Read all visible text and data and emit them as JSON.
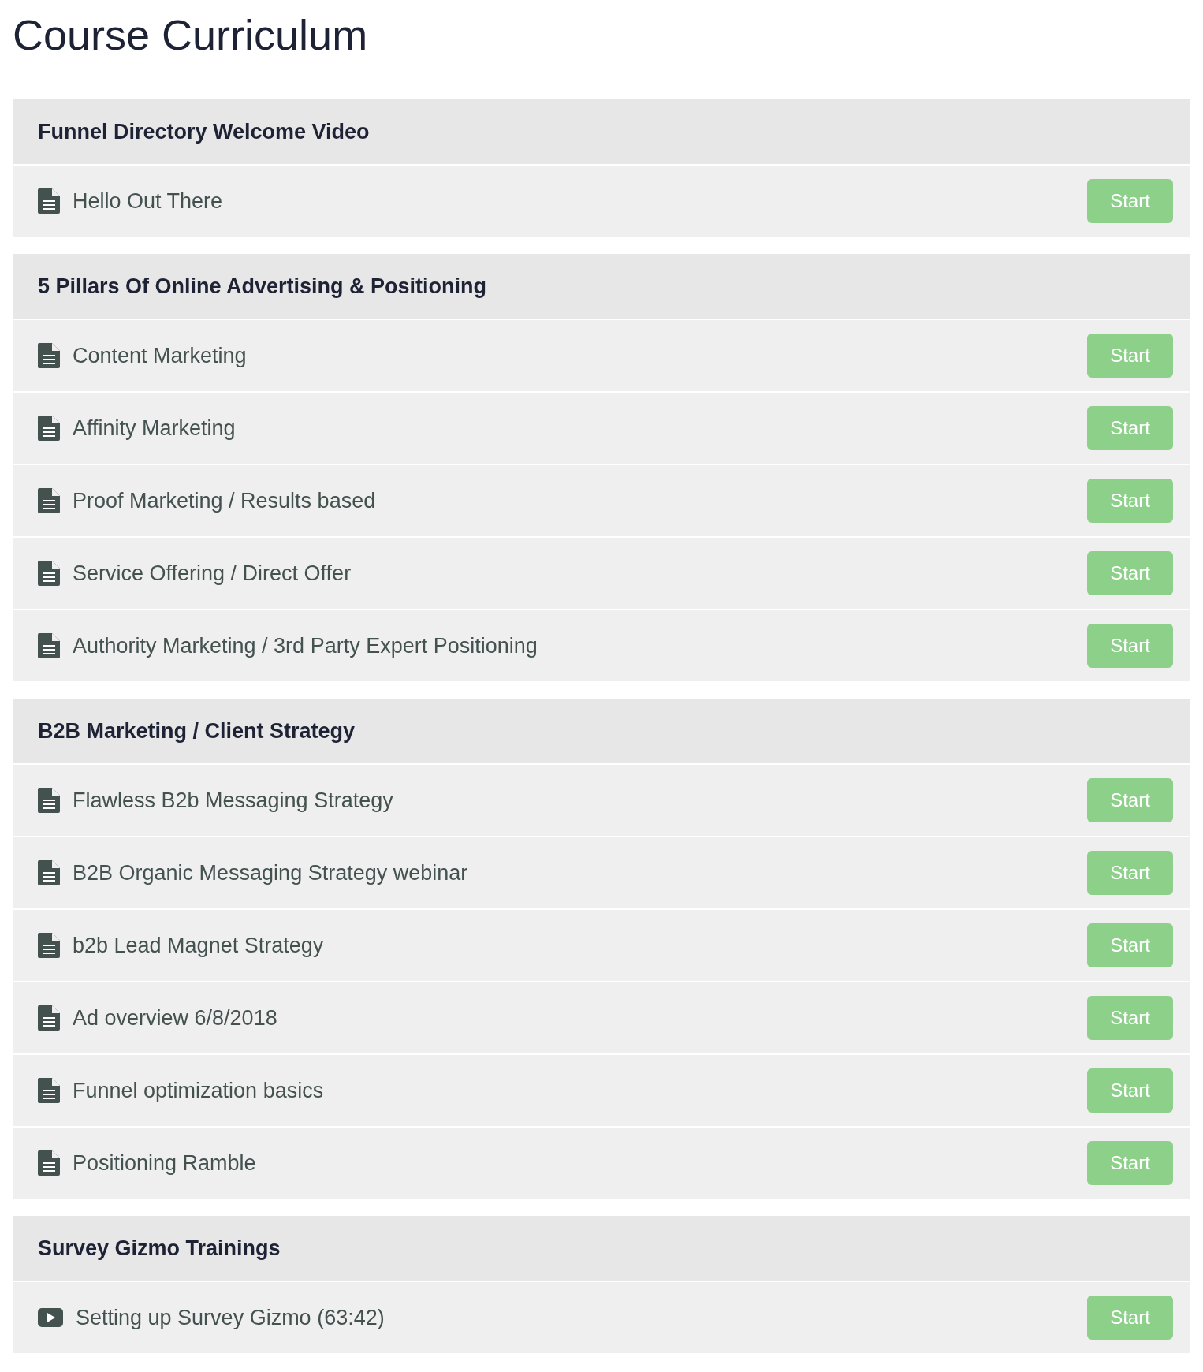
{
  "title": "Course Curriculum",
  "sections": [
    {
      "title": "Funnel Directory Welcome Video",
      "lessons": [
        {
          "kind": "document",
          "title": "Hello Out There",
          "button": "Start"
        }
      ]
    },
    {
      "title": "5 Pillars Of Online Advertising & Positioning",
      "lessons": [
        {
          "kind": "document",
          "title": "Content Marketing",
          "button": "Start"
        },
        {
          "kind": "document",
          "title": "Affinity Marketing",
          "button": "Start"
        },
        {
          "kind": "document",
          "title": "Proof Marketing / Results based",
          "button": "Start"
        },
        {
          "kind": "document",
          "title": "Service Offering / Direct Offer",
          "button": "Start"
        },
        {
          "kind": "document",
          "title": "Authority Marketing / 3rd Party Expert Positioning",
          "button": "Start"
        }
      ]
    },
    {
      "title": "B2B Marketing / Client Strategy",
      "lessons": [
        {
          "kind": "document",
          "title": "Flawless B2b Messaging Strategy",
          "button": "Start"
        },
        {
          "kind": "document",
          "title": "B2B Organic Messaging Strategy webinar",
          "button": "Start"
        },
        {
          "kind": "document",
          "title": "b2b Lead Magnet Strategy",
          "button": "Start"
        },
        {
          "kind": "document",
          "title": "Ad overview 6/8/2018",
          "button": "Start"
        },
        {
          "kind": "document",
          "title": "Funnel optimization basics",
          "button": "Start"
        },
        {
          "kind": "document",
          "title": "Positioning Ramble",
          "button": "Start"
        }
      ]
    },
    {
      "title": "Survey Gizmo Trainings",
      "lessons": [
        {
          "kind": "video",
          "title": "Setting up Survey Gizmo (63:42)",
          "button": "Start"
        }
      ]
    }
  ]
}
